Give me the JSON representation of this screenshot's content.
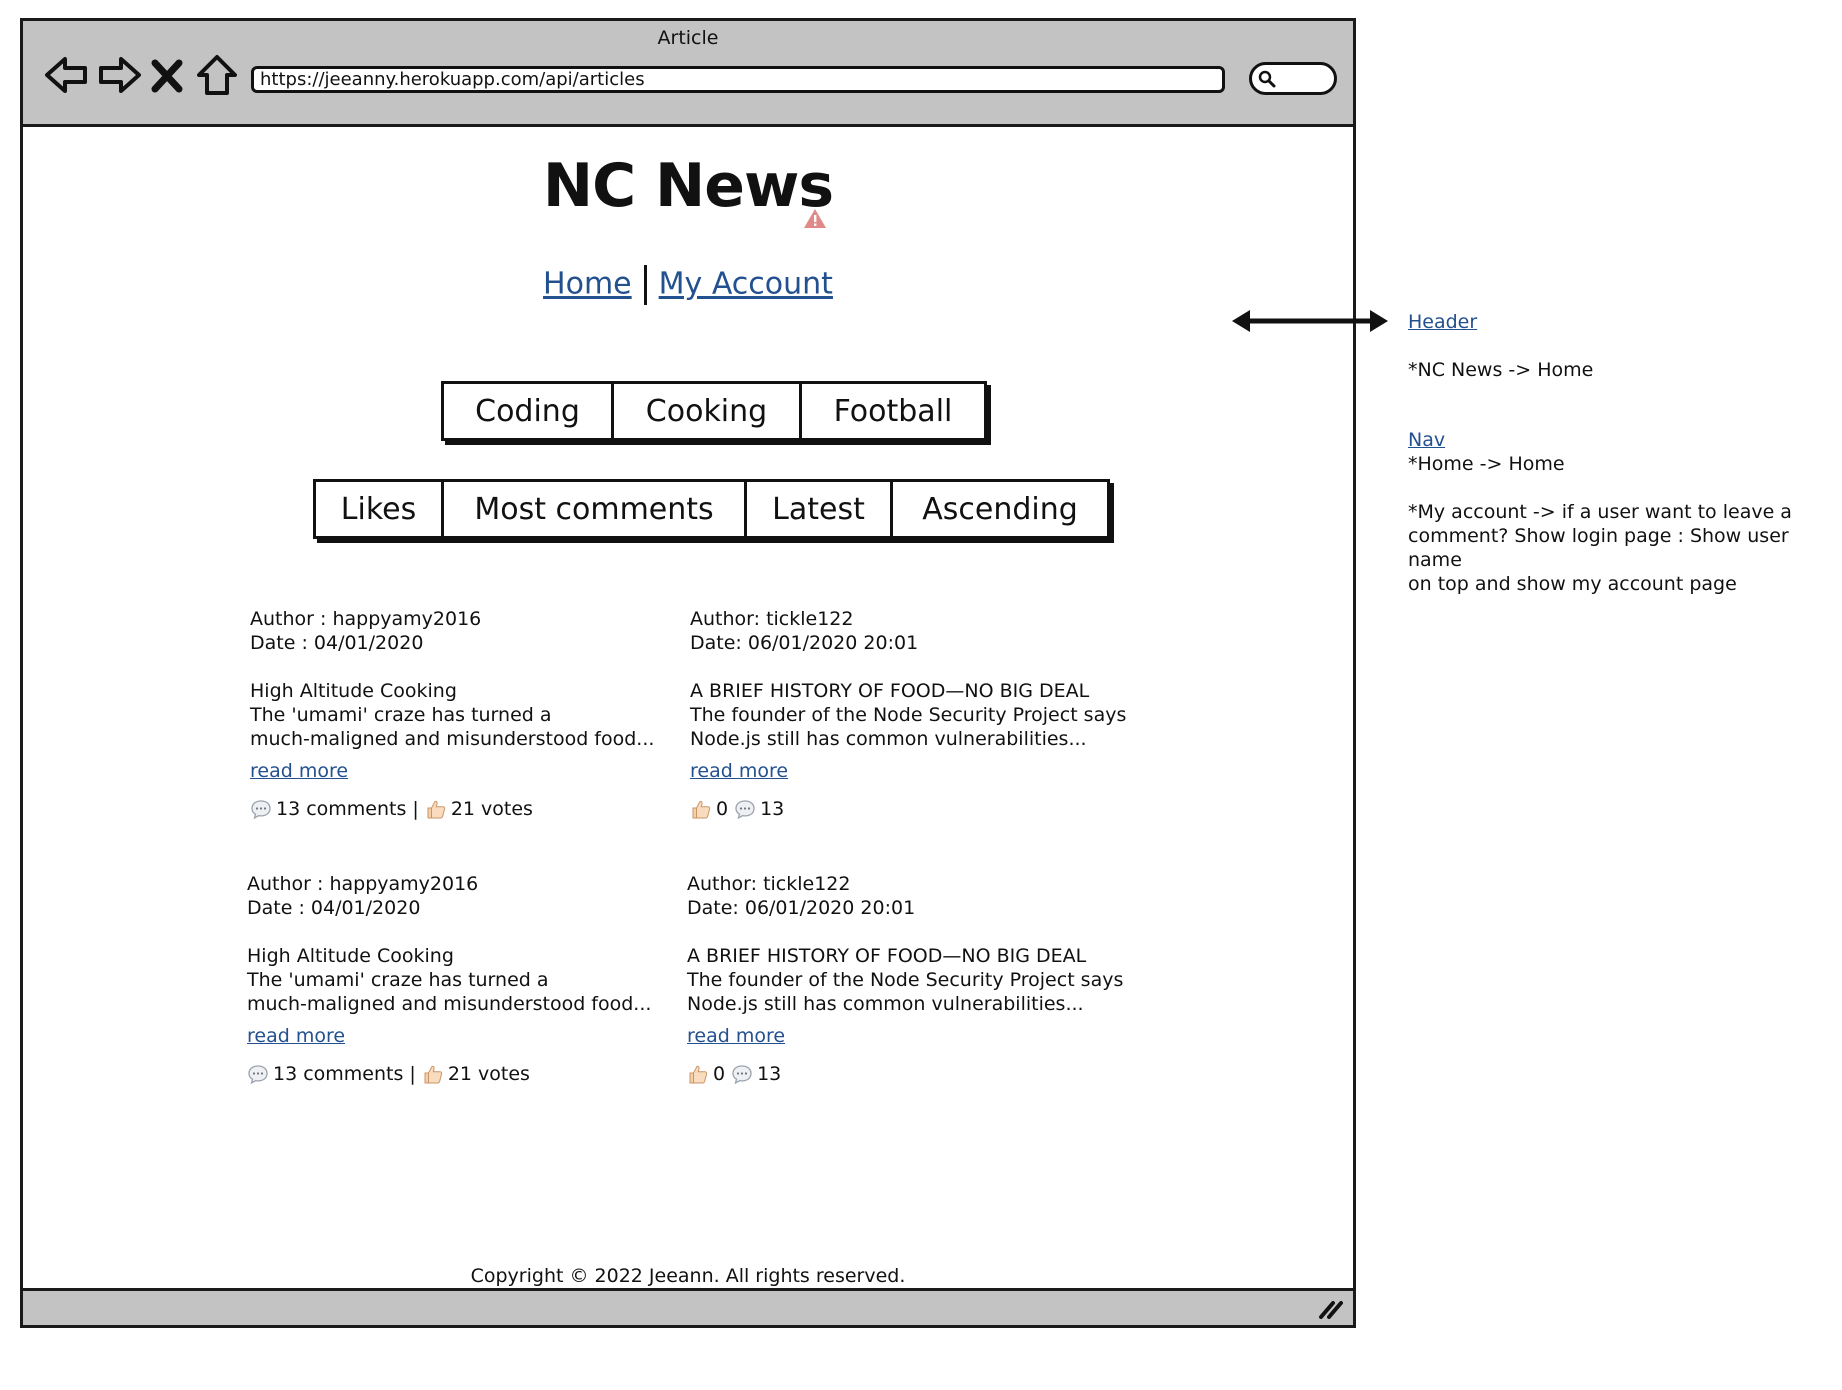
{
  "browser": {
    "window_title": "Article",
    "url": "https://jeeanny.herokuapp.com/api/articles"
  },
  "header": {
    "site_title": "NC News"
  },
  "nav": {
    "home": "Home",
    "my_account": "My Account"
  },
  "topics": [
    "Coding",
    "Cooking",
    "Football"
  ],
  "sort_options": [
    "Likes",
    "Most comments",
    "Latest",
    "Ascending"
  ],
  "articles": [
    {
      "author": "Author : happyamy2016",
      "date": "Date : 04/01/2020",
      "title": "High Altitude Cooking",
      "excerpt_line1": "The 'umami' craze has turned a",
      "excerpt_line2": "much-maligned and misunderstood food...",
      "read_more": "read more",
      "comments": "13 comments |",
      "votes": "21 votes"
    },
    {
      "author": "Author: tickle122",
      "date": "Date: 06/01/2020 20:01",
      "title": "A BRIEF HISTORY OF FOOD—NO BIG DEAL",
      "excerpt_line1": "The founder of the Node Security Project says",
      "excerpt_line2": "Node.js still has common vulnerabilities...",
      "read_more": "read more",
      "votes": "0",
      "comments": "13"
    },
    {
      "author": "Author : happyamy2016",
      "date": "Date : 04/01/2020",
      "title": "High Altitude Cooking",
      "excerpt_line1": "The 'umami' craze has turned a",
      "excerpt_line2": "much-maligned and misunderstood food...",
      "read_more": "read more",
      "comments": "13 comments |",
      "votes": "21 votes"
    },
    {
      "author": "Author: tickle122",
      "date": "Date: 06/01/2020 20:01",
      "title": "A BRIEF HISTORY OF FOOD—NO BIG DEAL",
      "excerpt_line1": "The founder of the Node Security Project says",
      "excerpt_line2": "Node.js still has common vulnerabilities...",
      "read_more": "read more",
      "votes": "0",
      "comments": "13"
    }
  ],
  "footer": {
    "copyright": "Copyright © 2022 Jeeann. All rights reserved."
  },
  "annotations": {
    "header_link": "Header",
    "header_note": "*NC News -> Home",
    "nav_link": "Nav",
    "nav_note1": "*Home -> Home",
    "nav_note2_line1": "*My account -> if a user want to leave a",
    "nav_note2_line2": "comment? Show login page : Show user name",
    "nav_note2_line3": "on top and show my account page"
  },
  "icons": {
    "back": "back-arrow-icon",
    "forward": "forward-arrow-icon",
    "stop": "stop-x-icon",
    "home": "home-icon",
    "search": "search-icon",
    "comment": "speech-bubble-icon",
    "vote": "thumbs-up-icon",
    "warning": "warning-triangle-icon"
  },
  "colors": {
    "link": "#23508f",
    "chrome": "#c3c3c3",
    "ink": "#111111"
  }
}
